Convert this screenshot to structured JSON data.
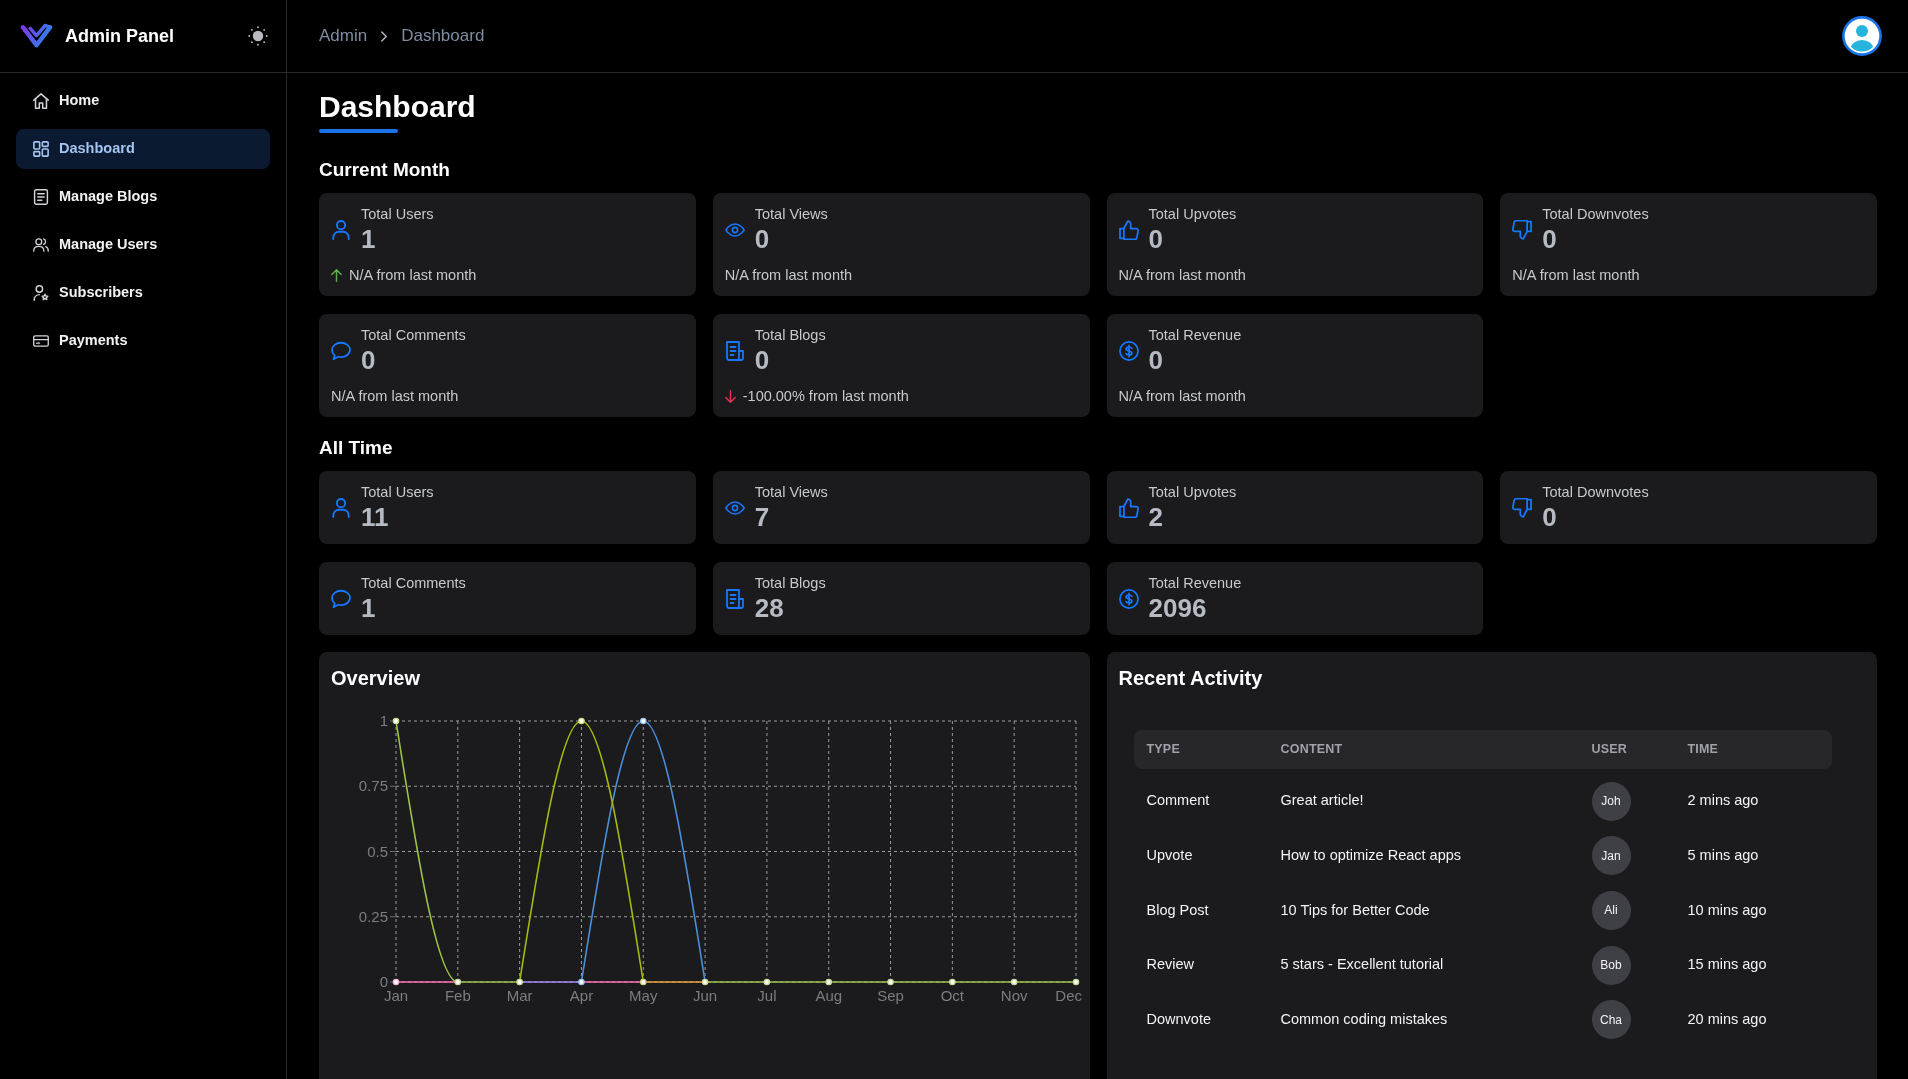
{
  "sidebar": {
    "brand": "Admin Panel",
    "items": [
      {
        "label": "Home",
        "kind": "home",
        "selected": false
      },
      {
        "label": "Dashboard",
        "kind": "dashboard",
        "selected": true
      },
      {
        "label": "Manage Blogs",
        "kind": "blogs",
        "selected": false
      },
      {
        "label": "Manage Users",
        "kind": "users",
        "selected": false
      },
      {
        "label": "Subscribers",
        "kind": "subscribers",
        "selected": false
      },
      {
        "label": "Payments",
        "kind": "payments",
        "selected": false
      }
    ]
  },
  "header": {
    "breadcrumb": [
      "Admin",
      "Dashboard"
    ]
  },
  "page_title": "Dashboard",
  "sections": [
    {
      "title": "Current Month",
      "cards": [
        {
          "kind": "users",
          "label": "Total Users",
          "value": "1",
          "change": {
            "kind": "up",
            "text": "N/A from last month"
          }
        },
        {
          "kind": "views",
          "label": "Total Views",
          "value": "0",
          "change": {
            "kind": "none",
            "text": "N/A from last month"
          }
        },
        {
          "kind": "upvotes",
          "label": "Total Upvotes",
          "value": "0",
          "change": {
            "kind": "none",
            "text": "N/A from last month"
          }
        },
        {
          "kind": "downvotes",
          "label": "Total Downvotes",
          "value": "0",
          "change": {
            "kind": "none",
            "text": "N/A from last month"
          }
        },
        {
          "kind": "comments",
          "label": "Total Comments",
          "value": "0",
          "change": {
            "kind": "none",
            "text": "N/A from last month"
          }
        },
        {
          "kind": "blogs",
          "label": "Total Blogs",
          "value": "0",
          "change": {
            "kind": "down",
            "text": "-100.00% from last month"
          }
        },
        {
          "kind": "revenue",
          "label": "Total Revenue",
          "value": "0",
          "change": {
            "kind": "none",
            "text": "N/A from last month"
          }
        }
      ]
    },
    {
      "title": "All Time",
      "cards": [
        {
          "kind": "users",
          "label": "Total Users",
          "value": "11"
        },
        {
          "kind": "views",
          "label": "Total Views",
          "value": "7"
        },
        {
          "kind": "upvotes",
          "label": "Total Upvotes",
          "value": "2"
        },
        {
          "kind": "downvotes",
          "label": "Total Downvotes",
          "value": "0"
        },
        {
          "kind": "comments",
          "label": "Total Comments",
          "value": "1"
        },
        {
          "kind": "blogs",
          "label": "Total Blogs",
          "value": "28"
        },
        {
          "kind": "revenue",
          "label": "Total Revenue",
          "value": "2096"
        }
      ]
    }
  ],
  "overview": {
    "title": "Overview",
    "chart_data": {
      "type": "line",
      "grid": true,
      "categories": [
        "Jan",
        "Feb",
        "Mar",
        "Apr",
        "May",
        "Jun",
        "Jul",
        "Aug",
        "Sep",
        "Oct",
        "Nov",
        "Dec"
      ],
      "ylim": [
        0,
        1
      ],
      "yticks": [
        0,
        0.25,
        0.5,
        0.75,
        1
      ],
      "series": [
        {
          "color": "#ff6fb5",
          "marker": true,
          "values": [
            0,
            0,
            null,
            0,
            0,
            null,
            null,
            null,
            null,
            null,
            null,
            null
          ]
        },
        {
          "color": "#a48bf5",
          "marker": false,
          "values": [
            null,
            null,
            0,
            0,
            null,
            null,
            null,
            null,
            null,
            null,
            null,
            null
          ]
        },
        {
          "color": "#e9a23b",
          "marker": false,
          "values": [
            null,
            null,
            null,
            null,
            0,
            0,
            null,
            null,
            null,
            null,
            null,
            null
          ]
        },
        {
          "color": "#4a90d9",
          "marker": true,
          "values": [
            null,
            null,
            null,
            0,
            1,
            0,
            null,
            null,
            null,
            null,
            null,
            null
          ]
        },
        {
          "color": "#a8b90f",
          "marker": true,
          "values": [
            null,
            null,
            0,
            1,
            0,
            null,
            null,
            null,
            null,
            null,
            null,
            null
          ]
        },
        {
          "color": "#9cc247",
          "marker": true,
          "values": [
            1,
            0,
            0,
            null,
            null,
            0,
            0,
            0,
            0,
            0,
            0,
            0
          ]
        }
      ]
    }
  },
  "recent_activity": {
    "title": "Recent Activity",
    "columns": [
      "TYPE",
      "CONTENT",
      "USER",
      "TIME"
    ],
    "rows": [
      {
        "type": "Comment",
        "content": "Great article!",
        "user": "Joh",
        "time": "2 mins ago"
      },
      {
        "type": "Upvote",
        "content": "How to optimize React apps",
        "user": "Jan",
        "time": "5 mins ago"
      },
      {
        "type": "Blog Post",
        "content": "10 Tips for Better Code",
        "user": "Ali",
        "time": "10 mins ago"
      },
      {
        "type": "Review",
        "content": "5 stars - Excellent tutorial",
        "user": "Bob",
        "time": "15 mins ago"
      },
      {
        "type": "Downvote",
        "content": "Common coding mistakes",
        "user": "Cha",
        "time": "20 mins ago"
      }
    ]
  }
}
